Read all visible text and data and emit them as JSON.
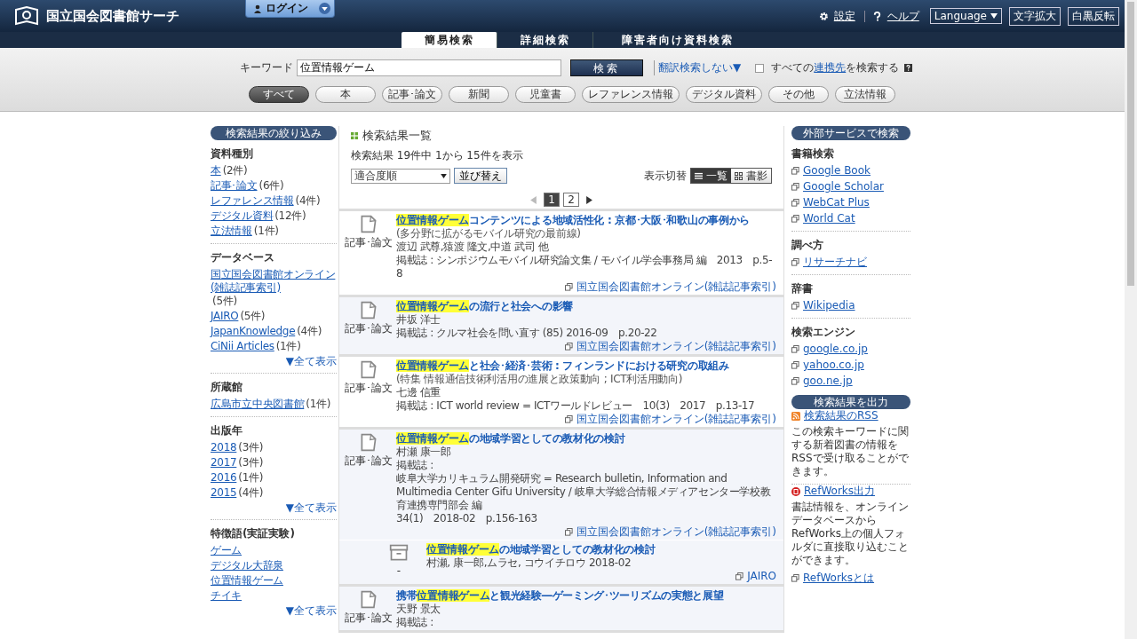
{
  "header": {
    "site_title": "国立国会図書館サーチ",
    "login": "ログイン",
    "links": [
      {
        "kind": "settings",
        "label": "設定"
      },
      {
        "kind": "help",
        "label": "ヘルプ"
      }
    ],
    "language": "Language",
    "buttons": [
      "文字拡大",
      "白黒反転"
    ]
  },
  "tabs": [
    {
      "label": "簡易検索",
      "selected": true
    },
    {
      "label": "詳細検索",
      "selected": false
    },
    {
      "label": "障害者向け資料検索",
      "selected": false
    }
  ],
  "search": {
    "keyword_label": "キーワード",
    "value": "位置情報ゲーム",
    "button": "検索",
    "translate_toggle": "翻訳検索しない▼",
    "partners": {
      "checked": false,
      "before": "すべての",
      "link": "連携先",
      "after": "を検索する"
    }
  },
  "categories": [
    {
      "label": "すべて",
      "selected": true
    },
    {
      "label": "本",
      "selected": false
    },
    {
      "label": "記事･論文",
      "selected": false
    },
    {
      "label": "新聞",
      "selected": false
    },
    {
      "label": "児童書",
      "selected": false
    },
    {
      "label": "レファレンス情報",
      "selected": false
    },
    {
      "label": "デジタル資料",
      "selected": false
    },
    {
      "label": "その他",
      "selected": false
    },
    {
      "label": "立法情報",
      "selected": false
    }
  ],
  "filter": {
    "title": "検索結果の絞り込み",
    "sections": [
      {
        "heading": "資料種別",
        "items": [
          {
            "label": "本",
            "count": "(2件)"
          },
          {
            "label": "記事･論文",
            "count": "(6件)"
          },
          {
            "label": "レファレンス情報",
            "count": "(4件)"
          },
          {
            "label": "デジタル資料",
            "count": "(12件)"
          },
          {
            "label": "立法情報",
            "count": "(1件)"
          }
        ]
      },
      {
        "heading": "データベース",
        "items": [
          {
            "label": "国立国会図書館オンライン(雑誌記事索引)",
            "count": "(5件)"
          },
          {
            "label": "JAIRO",
            "count": "(5件)"
          },
          {
            "label": "JapanKnowledge",
            "count": "(4件)"
          },
          {
            "label": "CiNii Articles",
            "count": "(1件)"
          }
        ],
        "more": "▼全て表示"
      },
      {
        "heading": "所蔵館",
        "items": [
          {
            "label": "広島市立中央図書館",
            "count": "(1件)"
          }
        ]
      },
      {
        "heading": "出版年",
        "items": [
          {
            "label": "2018",
            "count": "(3件)"
          },
          {
            "label": "2017",
            "count": "(3件)"
          },
          {
            "label": "2016",
            "count": "(1件)"
          },
          {
            "label": "2015",
            "count": "(4件)"
          }
        ],
        "more": "▼全て表示"
      },
      {
        "heading": "特徴語(実証実験)",
        "items": [
          {
            "label": "ゲーム"
          },
          {
            "label": "デジタル大辞泉"
          },
          {
            "label": "位置情報ゲーム"
          },
          {
            "label": "チイキ"
          }
        ],
        "more": "▼全て表示"
      }
    ]
  },
  "results_header": {
    "heading": "検索結果一覧",
    "summary": "検索結果 19件中 1から 15件を表示",
    "sort_value": "適合度順",
    "sort_button": "並び替え",
    "view_label": "表示切替",
    "views": [
      {
        "kind": "list",
        "label": "一覧",
        "selected": true
      },
      {
        "kind": "cover",
        "label": "書影",
        "selected": false
      }
    ],
    "pages": [
      {
        "label": "1",
        "selected": true
      },
      {
        "label": "2",
        "selected": false
      }
    ]
  },
  "results": [
    {
      "kind": "article",
      "type_label": "記事･論文",
      "highlight": "位置情報ゲーム",
      "after": "コンテンツによる地域活性化 : 京都･大阪･和歌山の事例から",
      "note": "(多分野に拡がるモバイル研究の最前線)",
      "authors": "渡辺 武尊,猿渡 隆文,中道 武司 他",
      "journal": "掲載誌 : シンポジウムモバイル研究論文集 / モバイル学会事務局 編　2013　p.5-8",
      "source": "国立国会図書館オンライン(雑誌記事索引)"
    },
    {
      "kind": "article",
      "type_label": "記事･論文",
      "highlight": "位置情報ゲーム",
      "after": "の流行と社会への影響",
      "authors": "井坂 洋士",
      "journal": "掲載誌 : クルマ社会を問い直す (85) 2016-09　p.20-22",
      "source": "国立国会図書館オンライン(雑誌記事索引)"
    },
    {
      "kind": "article",
      "type_label": "記事･論文",
      "highlight": "位置情報ゲーム",
      "after": "と社会･経済･芸術 : フィンランドにおける研究の取組み",
      "note": "(特集 情報通信技術利活用の進展と政策動向 ; ICT利活用動向)",
      "authors": "七邊 信重",
      "journal": "掲載誌 : ICT world review = ICTワールドレビュー　10(3)　2017　p.13-17",
      "source": "国立国会図書館オンライン(雑誌記事索引)"
    },
    {
      "kind": "article",
      "type_label": "記事･論文",
      "highlight": "位置情報ゲーム",
      "after": "の地域学習としての教材化の検討",
      "authors": "村瀬 康一郎",
      "journal_label": "掲載誌 :",
      "journal": "岐阜大学カリキュラム開発研究 = Research bulletin, Information and Multimedia Center Gifu University / 岐阜大学総合情報メディアセンター学校教育連携専門部会 編",
      "journal_issue": "34(1)　2018-02　p.156-163",
      "source": "国立国会図書館オンライン(雑誌記事索引)"
    },
    {
      "kind": "repository",
      "type_label": "-",
      "highlight": "位置情報ゲーム",
      "after": "の地域学習としての教材化の検討",
      "authors": "村瀬, 康一郎,ムラセ, コウイチロウ 2018-02",
      "source": "JAIRO"
    },
    {
      "kind": "article",
      "type_label": "記事･論文",
      "before": "携帯",
      "highlight": "位置情報ゲーム",
      "after": "と観光経験―ゲーミング･ツーリズムの実態と展望",
      "authors": "天野 景太",
      "journal_label": "掲載誌 :"
    }
  ],
  "external": {
    "title": "外部サービスで検索",
    "sections": [
      {
        "heading": "書籍検索",
        "links": [
          "Google Book",
          "Google Scholar",
          "WebCat Plus",
          "World Cat"
        ]
      },
      {
        "heading": "調べ方",
        "links": [
          "リサーチナビ"
        ]
      },
      {
        "heading": "辞書",
        "links": [
          "Wikipedia"
        ]
      },
      {
        "heading": "検索エンジン",
        "links": [
          "google.co.jp",
          "yahoo.co.jp",
          "goo.ne.jp"
        ]
      }
    ]
  },
  "output": {
    "title": "検索結果を出力",
    "rss_link": "検索結果のRSS",
    "rss_text": "この検索キーワードに関する新着図書の情報をRSSで受け取ることができます。",
    "refworks_link": "RefWorks出力",
    "refworks_text": "書誌情報を、オンラインデータベースからRefWorks上の個人フォルダに直接取り込むことができます。",
    "about_link": "RefWorksとは"
  }
}
